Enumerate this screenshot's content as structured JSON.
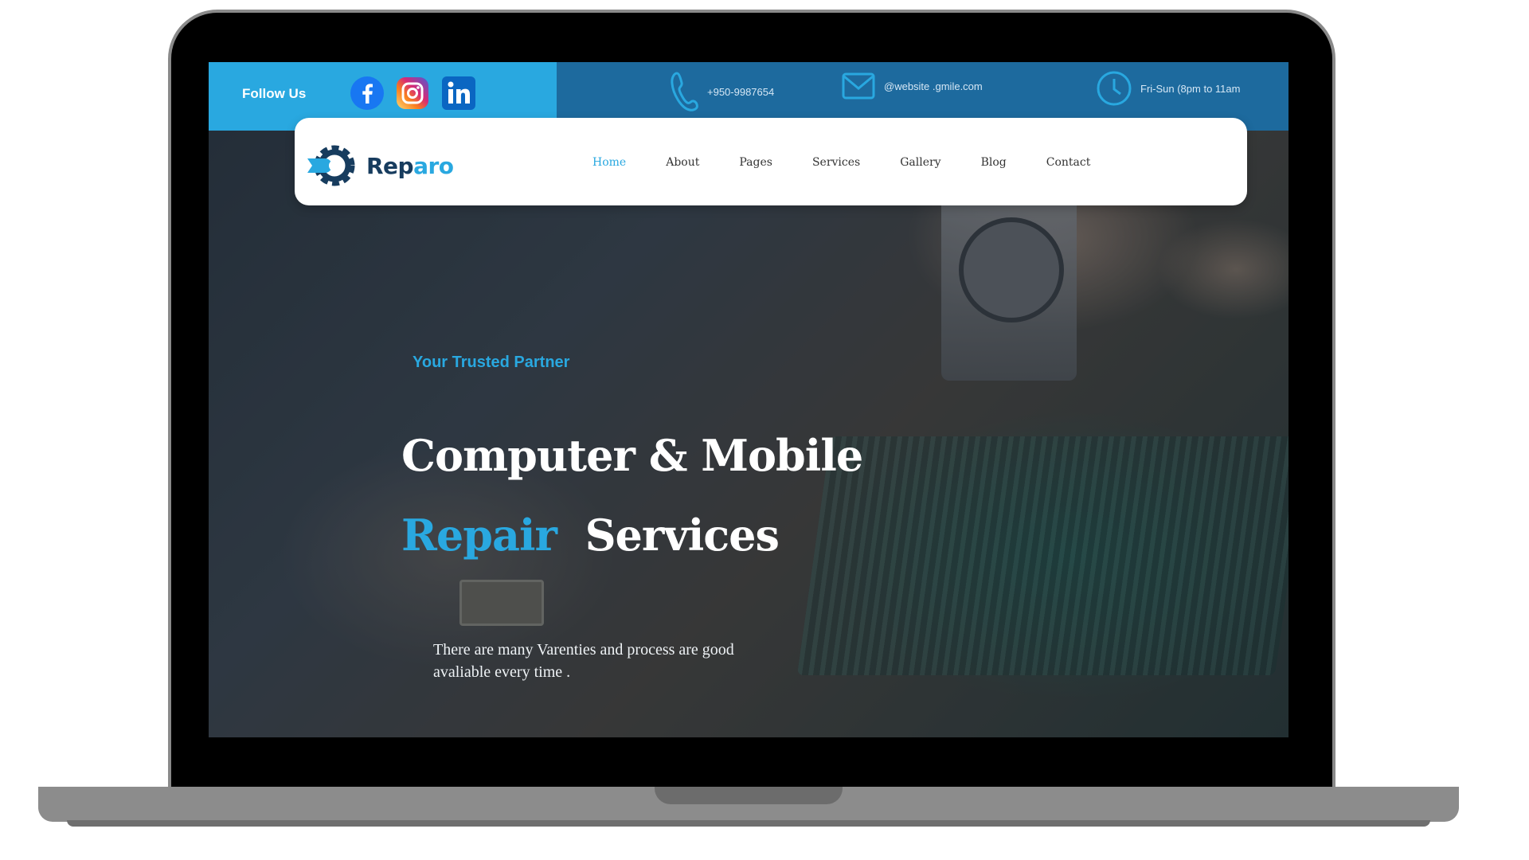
{
  "topbar": {
    "follow_label": "Follow Us",
    "socials": [
      {
        "icon": "facebook-icon",
        "color": "#1877f2"
      },
      {
        "icon": "instagram-icon",
        "color": "#d62976"
      },
      {
        "icon": "linkedin-icon",
        "color": "#0a66c2"
      }
    ],
    "phone": "+950-9987654",
    "email": "@website .gmile.com",
    "hours": "Fri-Sun (8pm to 11am"
  },
  "brand": {
    "name_part1": "Rep",
    "name_part2": "aro",
    "logo_icon": "gear-wrench-icon"
  },
  "nav": {
    "items": [
      "Home",
      "About",
      "Pages",
      "Services",
      "Gallery",
      "Blog",
      "Contact"
    ],
    "active": "Home"
  },
  "hero": {
    "eyebrow": "Your Trusted Partner",
    "title_line1": "Computer & Mobile",
    "title_line2_blue": "Repair",
    "title_line2_white": "Services",
    "desc_line1": "There are many Varenties and process are good",
    "desc_line2": "avaliable  every time ."
  },
  "colors": {
    "accent": "#29a8e0",
    "topbar_dark": "#1d6a9e",
    "brand_dark": "#173c5e"
  }
}
